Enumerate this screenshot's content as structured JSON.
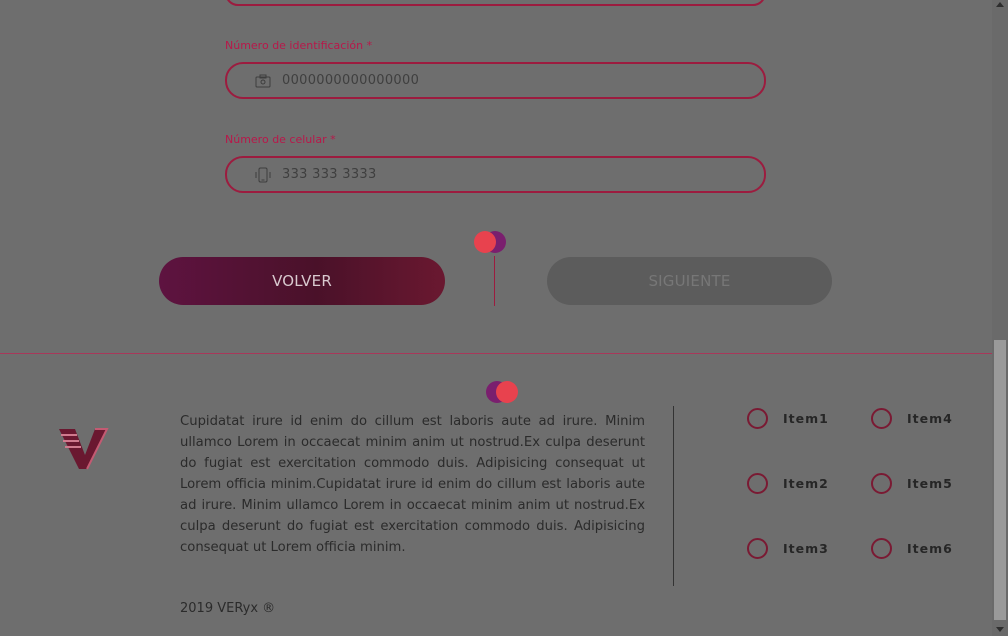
{
  "form": {
    "id_field": {
      "label": "Número de identificación *",
      "placeholder": "0000000000000000",
      "icon": "id-card-icon"
    },
    "phone_field": {
      "label": "Número de celular *",
      "placeholder": "333 333 3333",
      "icon": "mobile-phone-icon"
    }
  },
  "buttons": {
    "back_label": "VOLVER",
    "next_label": "SIGUIENTE"
  },
  "footer": {
    "description": "Cupidatat irure id enim do cillum est laboris aute ad irure. Minim ullamco Lorem in occaecat minim anim ut nostrud.Ex culpa deserunt do fugiat est exercitation commodo duis. Adipisicing consequat ut Lorem officia minim.Cupidatat irure id enim do cillum est laboris aute ad irure. Minim ullamco Lorem in occaecat minim anim ut nostrud.Ex culpa deserunt do fugiat est exercitation commodo duis. Adipisicing consequat ut Lorem officia minim.",
    "items": [
      "Item1",
      "Item2",
      "Item3",
      "Item4",
      "Item5",
      "Item6"
    ],
    "copyright": "2019 VERyx ®"
  },
  "colors": {
    "accent": "#9c1c3f",
    "dot_red": "#e8424e",
    "dot_purple": "#7a1f6e",
    "overlay_bg": "#6e6e6e"
  }
}
